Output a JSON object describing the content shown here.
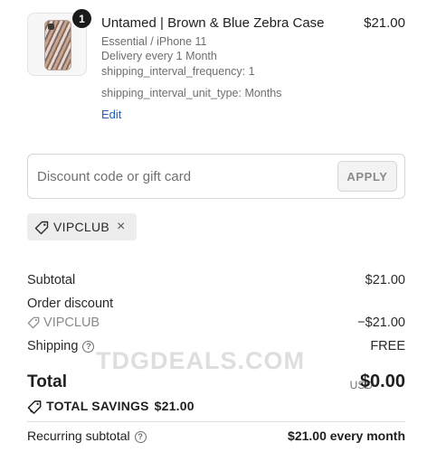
{
  "product": {
    "quantity_badge": "1",
    "title": "Untamed | Brown & Blue Zebra Case",
    "price": "$21.00",
    "variant": "Essential / iPhone 11",
    "delivery": "Delivery every 1 Month",
    "interval_frequency": "shipping_interval_frequency: 1",
    "interval_unit": "shipping_interval_unit_type: Months",
    "edit_label": "Edit"
  },
  "discount": {
    "placeholder": "Discount code or gift card",
    "value": "",
    "apply_label": "APPLY"
  },
  "applied_code": {
    "code": "VIPCLUB",
    "remove_symbol": "×"
  },
  "summary": {
    "subtotal_label": "Subtotal",
    "subtotal_value": "$21.00",
    "order_discount_label": "Order discount",
    "order_discount_code": "VIPCLUB",
    "order_discount_value": "−$21.00",
    "shipping_label": "Shipping",
    "shipping_value": "FREE",
    "total_label": "Total",
    "total_currency": "USD",
    "total_value": "$0.00",
    "savings_label": "TOTAL SAVINGS",
    "savings_value": "$21.00",
    "recurring_label": "Recurring subtotal",
    "recurring_value": "$21.00 every month"
  },
  "watermark": "TDGDEALS.COM",
  "colors": {
    "link": "#1f5fb0",
    "text": "#1f1f1f",
    "muted": "#8a8a8a",
    "tag_bg": "#ededed"
  }
}
